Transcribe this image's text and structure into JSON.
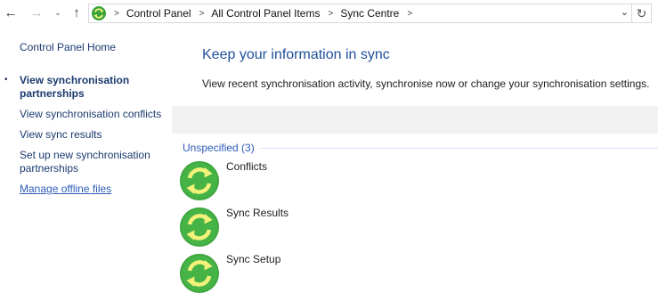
{
  "nav": {
    "back_icon": "arrow-left-icon",
    "forward_icon": "arrow-right-icon",
    "recent_icon": "chevron-down-icon",
    "up_icon": "arrow-up-icon",
    "back_glyph": "←",
    "forward_glyph": "→",
    "recent_glyph": "⌄",
    "up_glyph": "↑",
    "refresh_glyph": "↻",
    "dropdown_glyph": "⌄"
  },
  "address": {
    "breadcrumbs": [
      "Control Panel",
      "All Control Panel Items",
      "Sync Centre"
    ],
    "separator": ">"
  },
  "sidebar": {
    "home": "Control Panel Home",
    "bullet": "•",
    "items": [
      "View synchronisation partnerships",
      "View synchronisation conflicts",
      "View sync results",
      "Set up new synchronisation partnerships"
    ],
    "see_also": "Manage offline files"
  },
  "main": {
    "title": "Keep your information in sync",
    "description": "View recent synchronisation activity, synchronise now or change your synchronisation settings.",
    "group_label": "Unspecified (3)",
    "entries": [
      "Conflicts",
      "Sync Results",
      "Sync Setup"
    ]
  },
  "colors": {
    "accent": "#1e4f9c",
    "link": "#2e5cb8",
    "sync_green": "#3aa23a",
    "sync_arrow": "#f2f27a",
    "band": "#f2f2f2"
  }
}
